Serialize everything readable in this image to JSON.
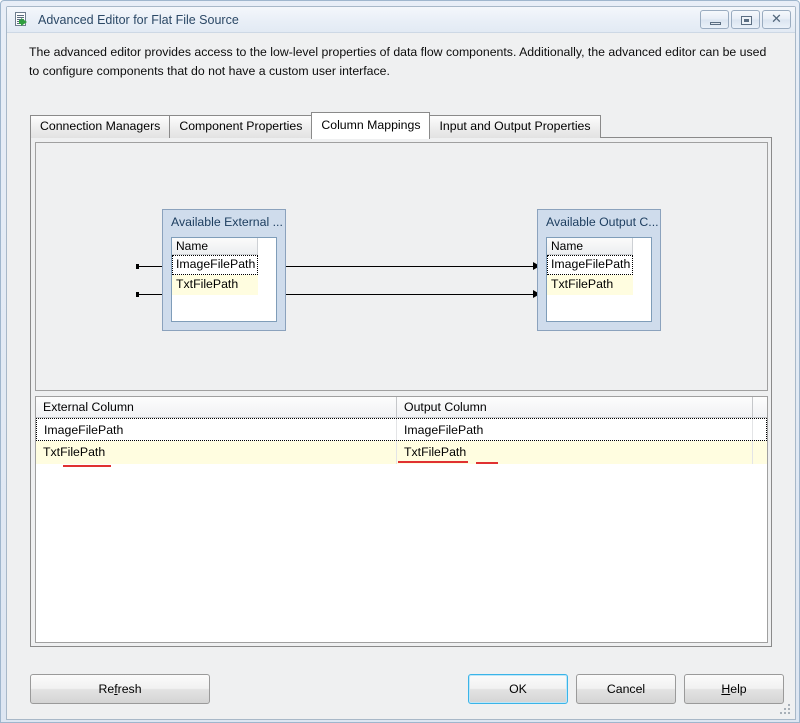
{
  "window": {
    "title": "Advanced Editor for Flat File Source",
    "icon": "document-arrow-icon",
    "minimize_label": "",
    "maximize_label": "",
    "close_label": "✕"
  },
  "description": "The advanced editor provides access to the low-level properties of data flow components. Additionally, the advanced editor can be used to configure components that do not have a custom user interface.",
  "tabs": [
    {
      "label": "Connection Managers",
      "active": false
    },
    {
      "label": "Component Properties",
      "active": false
    },
    {
      "label": "Column Mappings",
      "active": true
    },
    {
      "label": "Input and Output Properties",
      "active": false
    }
  ],
  "diagram": {
    "external_box": {
      "title": "Available External ...",
      "column_header": "Name",
      "rows": [
        {
          "label": "ImageFilePath",
          "state": "focused"
        },
        {
          "label": "TxtFilePath",
          "state": "highlighted"
        }
      ]
    },
    "output_box": {
      "title": "Available Output C...",
      "column_header": "Name",
      "rows": [
        {
          "label": "ImageFilePath",
          "state": "focused"
        },
        {
          "label": "TxtFilePath",
          "state": "highlighted"
        }
      ]
    },
    "mapping_lines": 2
  },
  "grid": {
    "headers": {
      "external": "External Column",
      "output": "Output Column"
    },
    "rows": [
      {
        "external": "ImageFilePath",
        "output": "ImageFilePath",
        "state": "focused"
      },
      {
        "external": "TxtFilePath",
        "output": "TxtFilePath",
        "state": "highlighted-annotated"
      }
    ]
  },
  "buttons": {
    "refresh": {
      "pre": "Re",
      "accel": "f",
      "post": "resh"
    },
    "ok": "OK",
    "cancel": "Cancel",
    "help": {
      "pre": "",
      "accel": "H",
      "post": "elp"
    }
  },
  "colors": {
    "accent": "#3ab4e8",
    "highlight_row": "#fffde0",
    "annotation": "#e03131",
    "title_text": "#2b4866",
    "box_fill": "#cfdcec"
  }
}
